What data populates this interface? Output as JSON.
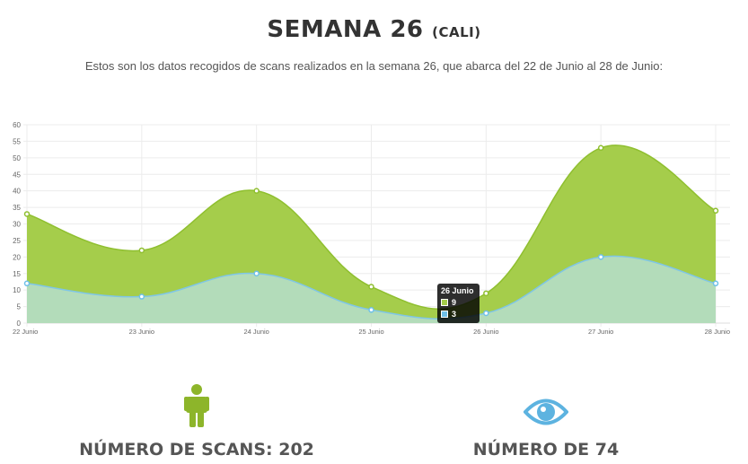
{
  "header": {
    "title": "SEMANA 26",
    "title_suffix": "(CALI)",
    "description": "Estos son los datos recogidos de scans realizados en la semana 26, que abarca del 22 de Junio al 28 de Junio:"
  },
  "chart_data": {
    "type": "area",
    "categories": [
      "22 Junio",
      "23 Junio",
      "24 Junio",
      "25 Junio",
      "26 Junio",
      "27 Junio",
      "28 Junio"
    ],
    "series": [
      {
        "color": "#a5cd4b",
        "values": [
          33,
          22,
          40,
          11,
          9,
          53,
          34
        ]
      },
      {
        "color": "#b3dcba",
        "values": [
          12,
          8,
          15,
          4,
          3,
          20,
          12
        ]
      }
    ],
    "ylim": [
      0,
      60
    ],
    "yticks": [
      0,
      5,
      10,
      15,
      20,
      25,
      30,
      35,
      40,
      45,
      50,
      55,
      60
    ],
    "grid": true,
    "tooltip": {
      "title": "26 Junio",
      "rows": [
        {
          "value": "9",
          "color": "#a5cd4b"
        },
        {
          "value": "3",
          "color": "#6fc0e8"
        }
      ]
    }
  },
  "stats": {
    "scans_label": "NÚMERO DE SCANS: 202",
    "views_label": "NÚMERO DE 74",
    "scans_icon": "person-icon",
    "views_icon": "eye-icon",
    "scans_icon_color": "#8db52a",
    "views_icon_color": "#5db3e0"
  }
}
